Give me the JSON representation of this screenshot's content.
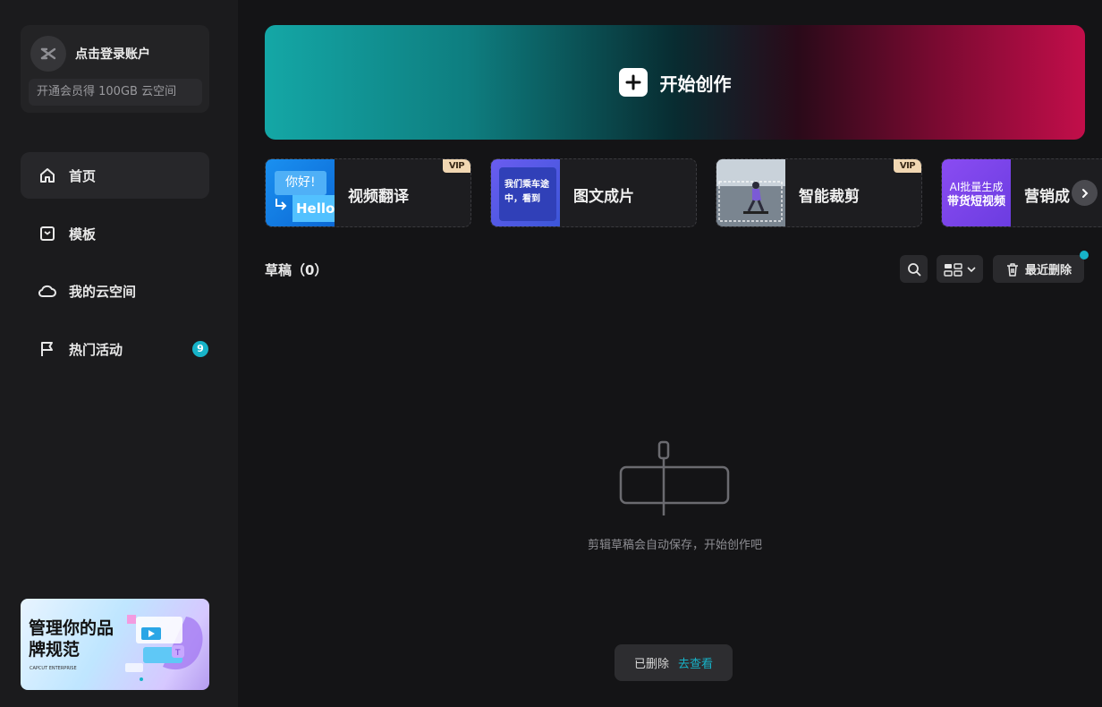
{
  "sidebar": {
    "account": {
      "login_label": "点击登录账户",
      "vip_promo": "开通会员得 100GB 云空间"
    },
    "nav": [
      {
        "label": "首页",
        "icon": "home-icon",
        "active": true
      },
      {
        "label": "模板",
        "icon": "template-icon"
      },
      {
        "label": "我的云空间",
        "icon": "cloud-icon"
      },
      {
        "label": "热门活动",
        "icon": "flag-icon",
        "badge": "9"
      }
    ],
    "promo_banner": {
      "title": "管理你的品牌规范",
      "logo_text": "CAPCUT ENTERPRISE"
    }
  },
  "hero": {
    "label": "开始创作",
    "icon": "plus-icon"
  },
  "tools": [
    {
      "label": "视频翻译",
      "vip": "VIP",
      "thumb_text_1": "你好!",
      "thumb_text_2": "Hello"
    },
    {
      "label": "图文成片",
      "thumb_text_1": "我们乘车途中，看到"
    },
    {
      "label": "智能裁剪",
      "vip": "VIP"
    },
    {
      "label": "营销成",
      "thumb_text_1": "AI批量生成",
      "thumb_text_2": "带货短视频"
    }
  ],
  "drafts": {
    "title": "草稿（0）",
    "recent_delete": "最近删除",
    "empty_text": "剪辑草稿会自动保存，开始创作吧"
  },
  "toast": {
    "text": "已删除",
    "link": "去查看"
  },
  "colors": {
    "accent": "#17b3c8",
    "vip": "#f1d7b2"
  }
}
